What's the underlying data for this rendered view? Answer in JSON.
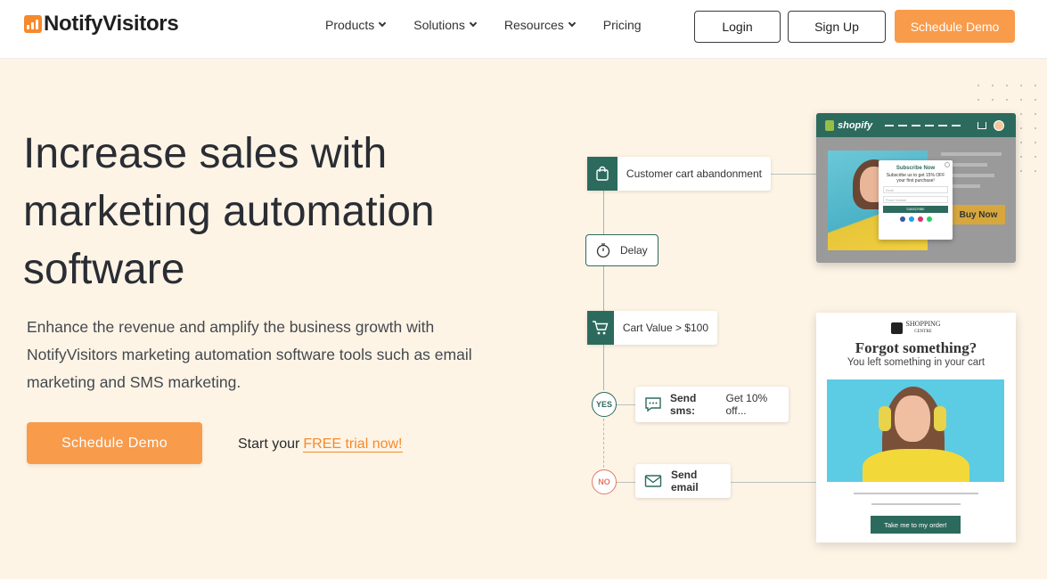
{
  "brand": {
    "logo_text": "NotifyVisitors"
  },
  "nav": {
    "items": [
      {
        "label": "Products",
        "has_dropdown": true
      },
      {
        "label": "Solutions",
        "has_dropdown": true
      },
      {
        "label": "Resources",
        "has_dropdown": true
      },
      {
        "label": "Pricing",
        "has_dropdown": false
      }
    ],
    "login_label": "Login",
    "signup_label": "Sign Up",
    "demo_label": "Schedule Demo"
  },
  "hero": {
    "title": "Increase sales with marketing automation software",
    "subtitle": "Enhance the revenue and amplify the business growth with NotifyVisitors marketing automation software tools such as email marketing and SMS marketing.",
    "cta_label": "Schedule Demo",
    "trial_prefix": "Start your",
    "trial_link": "FREE trial now!"
  },
  "workflow": {
    "trigger": "Customer cart abandonment",
    "delay": "Delay",
    "condition": "Cart Value > $100",
    "yes_tag": "YES",
    "no_tag": "NO",
    "sms_bold": "Send sms:",
    "sms_text": "Get 10% off...",
    "email_label": "Send email"
  },
  "shopify_mock": {
    "brand": "shopify",
    "popup_title": "Subscribe Now",
    "popup_text": "Subscribe us to get 15% OFF your first purchase!",
    "email_placeholder": "Email",
    "phone_placeholder": "Phone Number",
    "popup_button": "SUBSCRIBE",
    "buy_now": "Buy Now"
  },
  "email_mock": {
    "brand_line1": "SHOPPING",
    "brand_line2": "CENTRE",
    "heading": "Forgot something?",
    "subheading": "You left something in your cart",
    "button": "Take me to my order!"
  },
  "colors": {
    "accent_orange": "#f89b4b",
    "brand_green": "#2d6a5e",
    "hero_bg": "#fdf4e6"
  }
}
